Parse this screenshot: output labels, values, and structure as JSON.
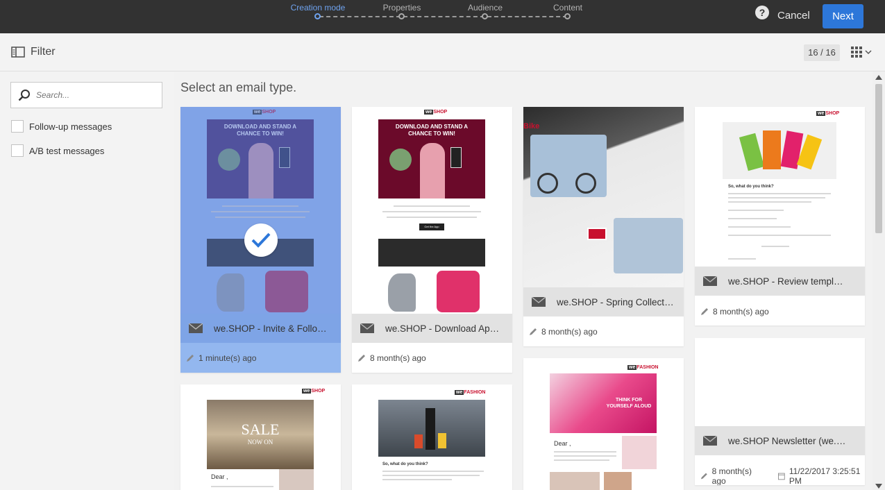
{
  "wizard": {
    "steps": [
      {
        "label": "Creation mode",
        "active": true
      },
      {
        "label": "Properties",
        "active": false
      },
      {
        "label": "Audience",
        "active": false
      },
      {
        "label": "Content",
        "active": false
      }
    ],
    "help_icon": "question-icon",
    "cancel_label": "Cancel",
    "next_label": "Next"
  },
  "toolbar": {
    "filter_label": "Filter",
    "count": "16 / 16",
    "view_icon": "grid-view-icon"
  },
  "sidebar": {
    "search_placeholder": "Search...",
    "filters": [
      {
        "label": "Follow-up messages",
        "checked": false
      },
      {
        "label": "A/B test messages",
        "checked": false
      }
    ]
  },
  "main": {
    "heading": "Select an email type.",
    "cards": [
      {
        "name": "we.SHOP - Invite & Follow ...",
        "modified": "1 minute(s) ago",
        "selected": true
      },
      {
        "name": "we.SHOP - Download App ...",
        "modified": "8 month(s) ago",
        "selected": false
      },
      {
        "name": "we.SHOP - Spring Collectio...",
        "modified": "8 month(s) ago",
        "selected": false
      },
      {
        "name": "we.SHOP - Review template (...",
        "modified": "8 month(s) ago",
        "selected": false
      },
      {
        "name": "we.SHOP Newsletter (we.SHO...",
        "modified": "8 month(s) ago",
        "date": "11/22/2017 3:25:51 PM",
        "selected": false
      }
    ],
    "thumbnail_text": {
      "download_headline": "DOWNLOAD AND STAND A CHANCE TO WIN!",
      "sale": "SALE",
      "now_on": "NOW ON",
      "dear": "Dear ,",
      "so_what": "So, what do you think?",
      "think_yourself": "THINK FOR YOURSELF ALOUD",
      "get_app": "Get the App",
      "bike": "Bike",
      "brand_we": "we",
      "brand_shop": "SHOP",
      "brand_fashion": "FASHION"
    }
  },
  "colors": {
    "accent": "#2d77d9",
    "selected_card": "#93b7ef",
    "topbar": "#323232"
  }
}
